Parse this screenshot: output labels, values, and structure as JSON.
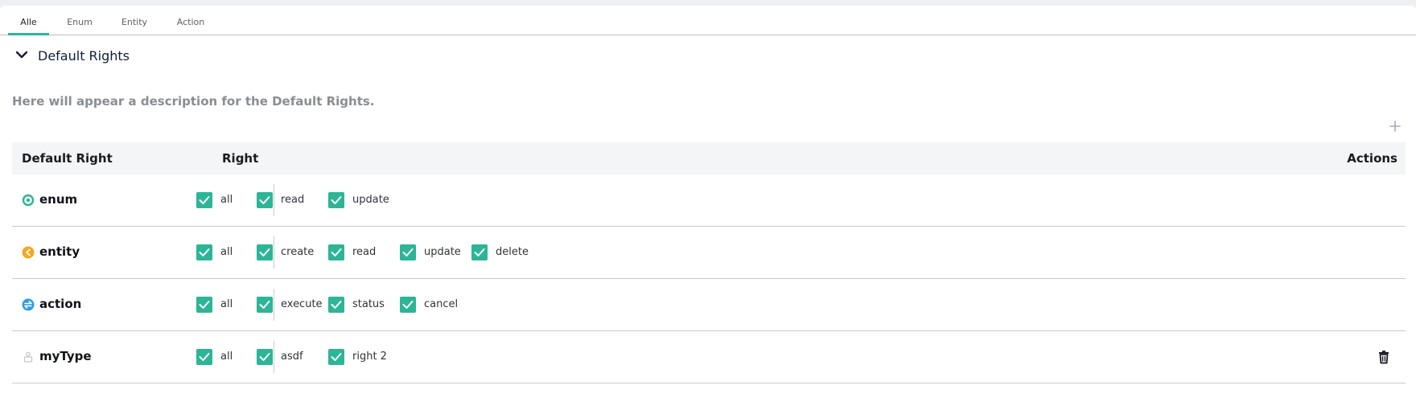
{
  "tabs": [
    "Alle",
    "Enum",
    "Entity",
    "Action"
  ],
  "active_tab": "Alle",
  "accent_color": "#2cb596",
  "section": {
    "title": "Default Rights",
    "expanded": true,
    "toggle_icon": "chevron-down-icon",
    "description": "Here will appear a description for the Default Rights.",
    "add_icon": "plus-icon"
  },
  "table": {
    "headers": {
      "name": "Default Right",
      "right": "Right",
      "actions": "Actions"
    },
    "rows": [
      {
        "name": "enum",
        "icon": "enum-icon",
        "icon_color": "#2cb596",
        "rights": [
          {
            "label": "all",
            "checked": true
          },
          {
            "label": "read",
            "checked": true
          },
          {
            "label": "update",
            "checked": true
          }
        ],
        "deletable": false
      },
      {
        "name": "entity",
        "icon": "entity-icon",
        "icon_color": "#f5a623",
        "rights": [
          {
            "label": "all",
            "checked": true
          },
          {
            "label": "create",
            "checked": true
          },
          {
            "label": "read",
            "checked": true
          },
          {
            "label": "update",
            "checked": true
          },
          {
            "label": "delete",
            "checked": true
          }
        ],
        "deletable": false
      },
      {
        "name": "action",
        "icon": "action-icon",
        "icon_color": "#2f9be0",
        "rights": [
          {
            "label": "all",
            "checked": true
          },
          {
            "label": "execute",
            "checked": true
          },
          {
            "label": "status",
            "checked": true
          },
          {
            "label": "cancel",
            "checked": true
          }
        ],
        "deletable": false
      },
      {
        "name": "myType",
        "icon": "custom-type-icon",
        "icon_color": "#c4c6cb",
        "rights": [
          {
            "label": "all",
            "checked": true
          },
          {
            "label": "asdf",
            "checked": true
          },
          {
            "label": "right 2",
            "checked": true
          }
        ],
        "deletable": true,
        "delete_icon": "trash-icon"
      }
    ]
  }
}
